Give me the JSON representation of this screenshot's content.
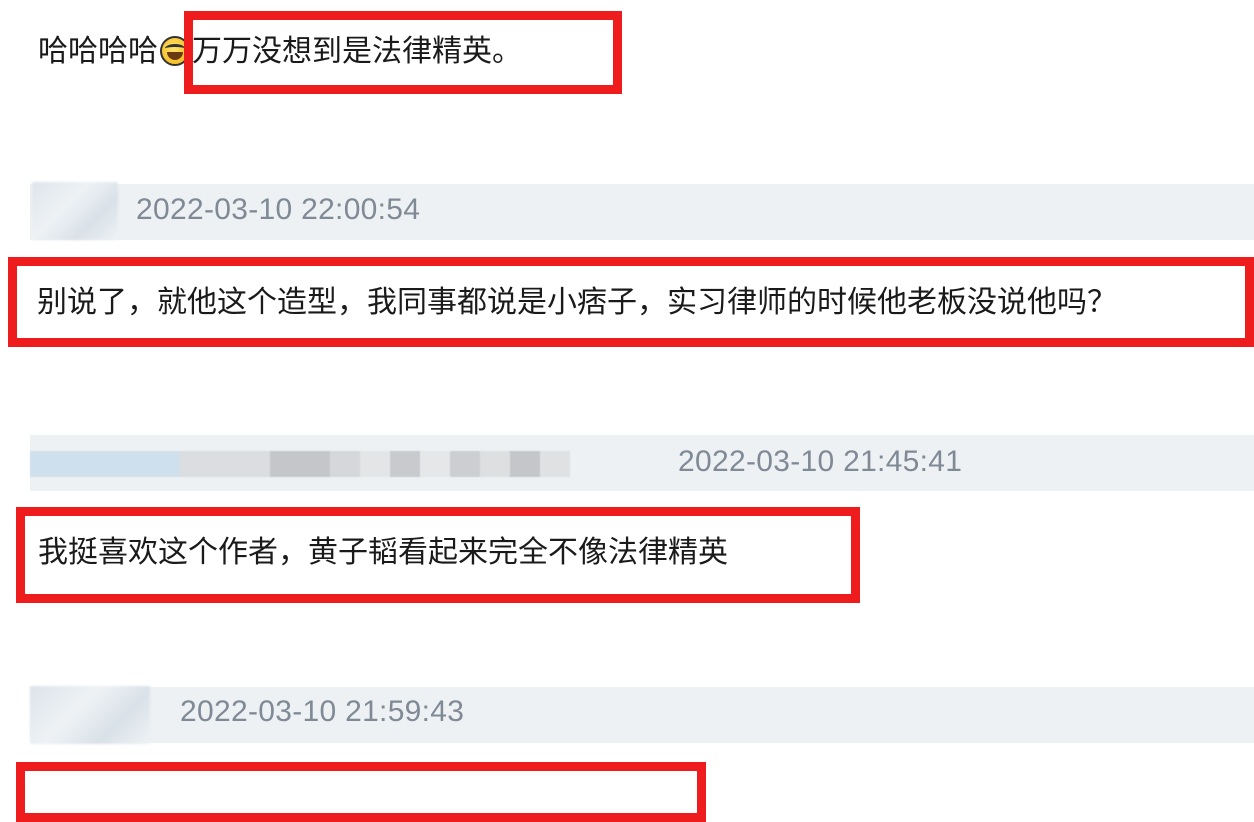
{
  "comments": [
    {
      "prefix": "哈哈哈哈",
      "emoji": "laughing-emoji",
      "text": "万万没想到是法律精英。"
    },
    {
      "timestamp": "2022-03-10 22:00:54",
      "text": "别说了，就他这个造型，我同事都说是小痞子，实习律师的时候他老板没说他吗？"
    },
    {
      "timestamp": "2022-03-10 21:45:41",
      "text": "我挺喜欢这个作者，黄子韬看起来完全不像法律精英"
    },
    {
      "timestamp": "2022-03-10 21:59:43"
    }
  ],
  "colors": {
    "highlight": "#ee1c1c",
    "meta_bar": "#eef1f3",
    "timestamp": "#7f8a96",
    "text": "#1a1a1a"
  }
}
